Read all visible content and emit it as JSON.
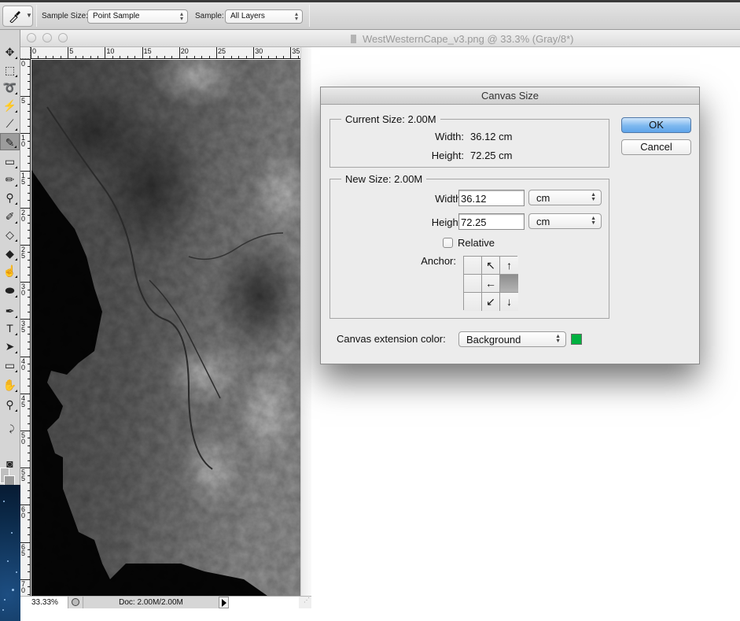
{
  "options_bar": {
    "tool_icon": "eyedropper-icon",
    "sample_size_label": "Sample Size:",
    "sample_size_value": "Point Sample",
    "sample_label": "Sample:",
    "sample_value": "All Layers"
  },
  "toolbar": {
    "tools": [
      {
        "name": "move-tool",
        "icon": "move-icon",
        "glyph": "✥"
      },
      {
        "name": "marquee-tool",
        "icon": "marquee-icon",
        "glyph": "⬚"
      },
      {
        "name": "lasso-tool",
        "icon": "lasso-icon",
        "glyph": "➰"
      },
      {
        "name": "magic-wand-tool",
        "icon": "magic-wand-icon",
        "glyph": "⚡"
      },
      {
        "name": "crop-tool",
        "icon": "crop-icon",
        "glyph": "⟋"
      },
      {
        "name": "eyedropper-tool",
        "icon": "eyedropper-icon",
        "glyph": "✎"
      },
      {
        "name": "healing-brush-tool",
        "icon": "bandage-icon",
        "glyph": "▭"
      },
      {
        "name": "brush-tool",
        "icon": "brush-icon",
        "glyph": "✏"
      },
      {
        "name": "clone-stamp-tool",
        "icon": "stamp-icon",
        "glyph": "⚲"
      },
      {
        "name": "history-brush-tool",
        "icon": "history-brush-icon",
        "glyph": "✐"
      },
      {
        "name": "eraser-tool",
        "icon": "eraser-icon",
        "glyph": "◇"
      },
      {
        "name": "paint-bucket-tool",
        "icon": "paint-bucket-icon",
        "glyph": "◆"
      },
      {
        "name": "smudge-tool",
        "icon": "smudge-icon",
        "glyph": "☝"
      },
      {
        "name": "dodge-tool",
        "icon": "sponge-icon",
        "glyph": "⬬"
      },
      {
        "name": "pen-tool",
        "icon": "pen-icon",
        "glyph": "✒"
      },
      {
        "name": "type-tool",
        "icon": "type-icon",
        "glyph": "T"
      },
      {
        "name": "path-selection-tool",
        "icon": "arrow-icon",
        "glyph": "➤"
      },
      {
        "name": "shape-tool",
        "icon": "rectangle-icon",
        "glyph": "▭"
      },
      {
        "name": "hand-tool",
        "icon": "hand-icon",
        "glyph": "✋"
      },
      {
        "name": "zoom-tool",
        "icon": "magnifier-icon",
        "glyph": "⚲"
      },
      {
        "name": "swap-colors",
        "icon": "swap-icon",
        "glyph": "⤸"
      },
      {
        "name": "quick-mask",
        "icon": "quick-mask-icon",
        "glyph": "◙"
      }
    ],
    "foreground_color": "#bfbfbf",
    "background_color": "#9b9b9b"
  },
  "document": {
    "title": "WestWesternCape_v3.png @ 33.3% (Gray/8*)",
    "ruler_h_labels": [
      "0",
      "5",
      "10",
      "15",
      "20",
      "25",
      "30",
      "35"
    ],
    "ruler_v_labels": [
      "0",
      "5",
      "10",
      "15",
      "20",
      "25",
      "30",
      "35",
      "40",
      "45",
      "50",
      "55",
      "60",
      "65",
      "70"
    ],
    "zoom": "33.33%",
    "doc_info": "Doc: 2.00M/2.00M"
  },
  "dialog": {
    "title": "Canvas Size",
    "current_size": {
      "title": "Current Size: 2.00M",
      "width_label": "Width:",
      "width_value": "36.12 cm",
      "height_label": "Height:",
      "height_value": "72.25 cm"
    },
    "new_size": {
      "title": "New Size: 2.00M",
      "width_label": "Width:",
      "width_value": "36.12",
      "width_unit": "cm",
      "height_label": "Height:",
      "height_value": "72.25",
      "height_unit": "cm",
      "relative_label": "Relative",
      "relative_checked": false,
      "anchor_label": "Anchor:",
      "anchor_selected": "middle-right",
      "anchor_cells": [
        "",
        "↖",
        "↑",
        "",
        "←",
        "",
        "",
        "↙",
        "↓"
      ]
    },
    "extension_color_label": "Canvas extension color:",
    "extension_color_value": "Background",
    "extension_color_swatch": "#00b140",
    "ok_label": "OK",
    "cancel_label": "Cancel"
  }
}
